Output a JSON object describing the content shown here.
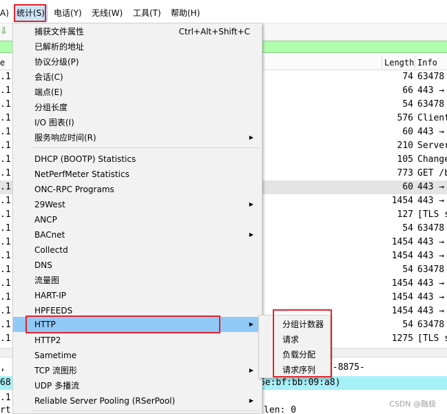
{
  "menubar": {
    "items": [
      {
        "label": "A)"
      },
      {
        "label": "统计(S)"
      },
      {
        "label": "电话(Y)"
      },
      {
        "label": "无线(W)"
      },
      {
        "label": "工具(T)"
      },
      {
        "label": "帮助(H)"
      }
    ]
  },
  "packet_list": {
    "headers": {
      "left": "e",
      "length": "Length",
      "info": "Info"
    },
    "rows": [
      {
        "left": ".1",
        "length": "74",
        "info": "63478"
      },
      {
        "left": ".1",
        "length": "66",
        "info": "443 →"
      },
      {
        "left": ".1",
        "length": "54",
        "info": "63478"
      },
      {
        "left": ".1",
        "length": "576",
        "info": "Client"
      },
      {
        "left": ".1",
        "length": "60",
        "info": "443 →"
      },
      {
        "left": ".1",
        "length": "210",
        "info": "Server"
      },
      {
        "left": ".1",
        "length": "105",
        "info": "Change"
      },
      {
        "left": ".1",
        "length": "773",
        "info": "GET /b"
      },
      {
        "left": ".1",
        "length": "60",
        "info": "443 →"
      },
      {
        "left": ".1",
        "length": "1454",
        "info": "443 →"
      },
      {
        "left": ".1",
        "length": "127",
        "info": "[TLS s"
      },
      {
        "left": ".1",
        "length": "54",
        "info": "63478"
      },
      {
        "left": ".1",
        "length": "1454",
        "info": "443 →"
      },
      {
        "left": ".1",
        "length": "1454",
        "info": "443 →"
      },
      {
        "left": ".1",
        "length": "54",
        "info": "63478"
      },
      {
        "left": ".1",
        "length": "1454",
        "info": "443 →"
      },
      {
        "left": ".1",
        "length": "1454",
        "info": "443 →"
      },
      {
        "left": ".1",
        "length": "1454",
        "info": "443 →"
      },
      {
        "left": ".1",
        "length": "54",
        "info": "63478"
      },
      {
        "left": ".1",
        "length": "1275",
        "info": "[TLS s"
      }
    ]
  },
  "detail": {
    "line1_left": ",",
    "line1_right": "6C2-4599-41B8-8875-",
    "line2_left": "68",
    "line2_right": "6e:bf:bb:09:a8)",
    "line3_left": ".1",
    "line4_left": "rt",
    "line4_right": "len: 0"
  },
  "stats_menu": {
    "items": [
      {
        "label": "捕获文件属性",
        "shortcut": "Ctrl+Alt+Shift+C"
      },
      {
        "label": "已解析的地址"
      },
      {
        "label": "协议分级(P)"
      },
      {
        "label": "会话(C)"
      },
      {
        "label": "端点(E)"
      },
      {
        "label": "分组长度"
      },
      {
        "label": "I/O 图表(I)"
      },
      {
        "label": "服务响应时间(R)"
      },
      {
        "label": "DHCP (BOOTP) Statistics"
      },
      {
        "label": "NetPerfMeter Statistics"
      },
      {
        "label": "ONC-RPC Programs"
      },
      {
        "label": "29West"
      },
      {
        "label": "ANCP"
      },
      {
        "label": "BACnet"
      },
      {
        "label": "Collectd"
      },
      {
        "label": "DNS"
      },
      {
        "label": "流量图"
      },
      {
        "label": "HART-IP"
      },
      {
        "label": "HPFEEDS"
      },
      {
        "label": "HTTP"
      },
      {
        "label": "HTTP2"
      },
      {
        "label": "Sametime"
      },
      {
        "label": "TCP 流图形"
      },
      {
        "label": "UDP 多播流"
      },
      {
        "label": "Reliable Server Pooling (RSerPool)"
      }
    ],
    "arrow": "▶"
  },
  "http_submenu": {
    "items": [
      {
        "label": "分组计数器"
      },
      {
        "label": "请求"
      },
      {
        "label": "负载分配"
      },
      {
        "label": "请求序列"
      }
    ]
  },
  "watermark": "CSDN @融极",
  "colors": {
    "highlight": "#91c9f7",
    "annotation_red": "#e0232b",
    "filter_green": "#afffaf"
  }
}
